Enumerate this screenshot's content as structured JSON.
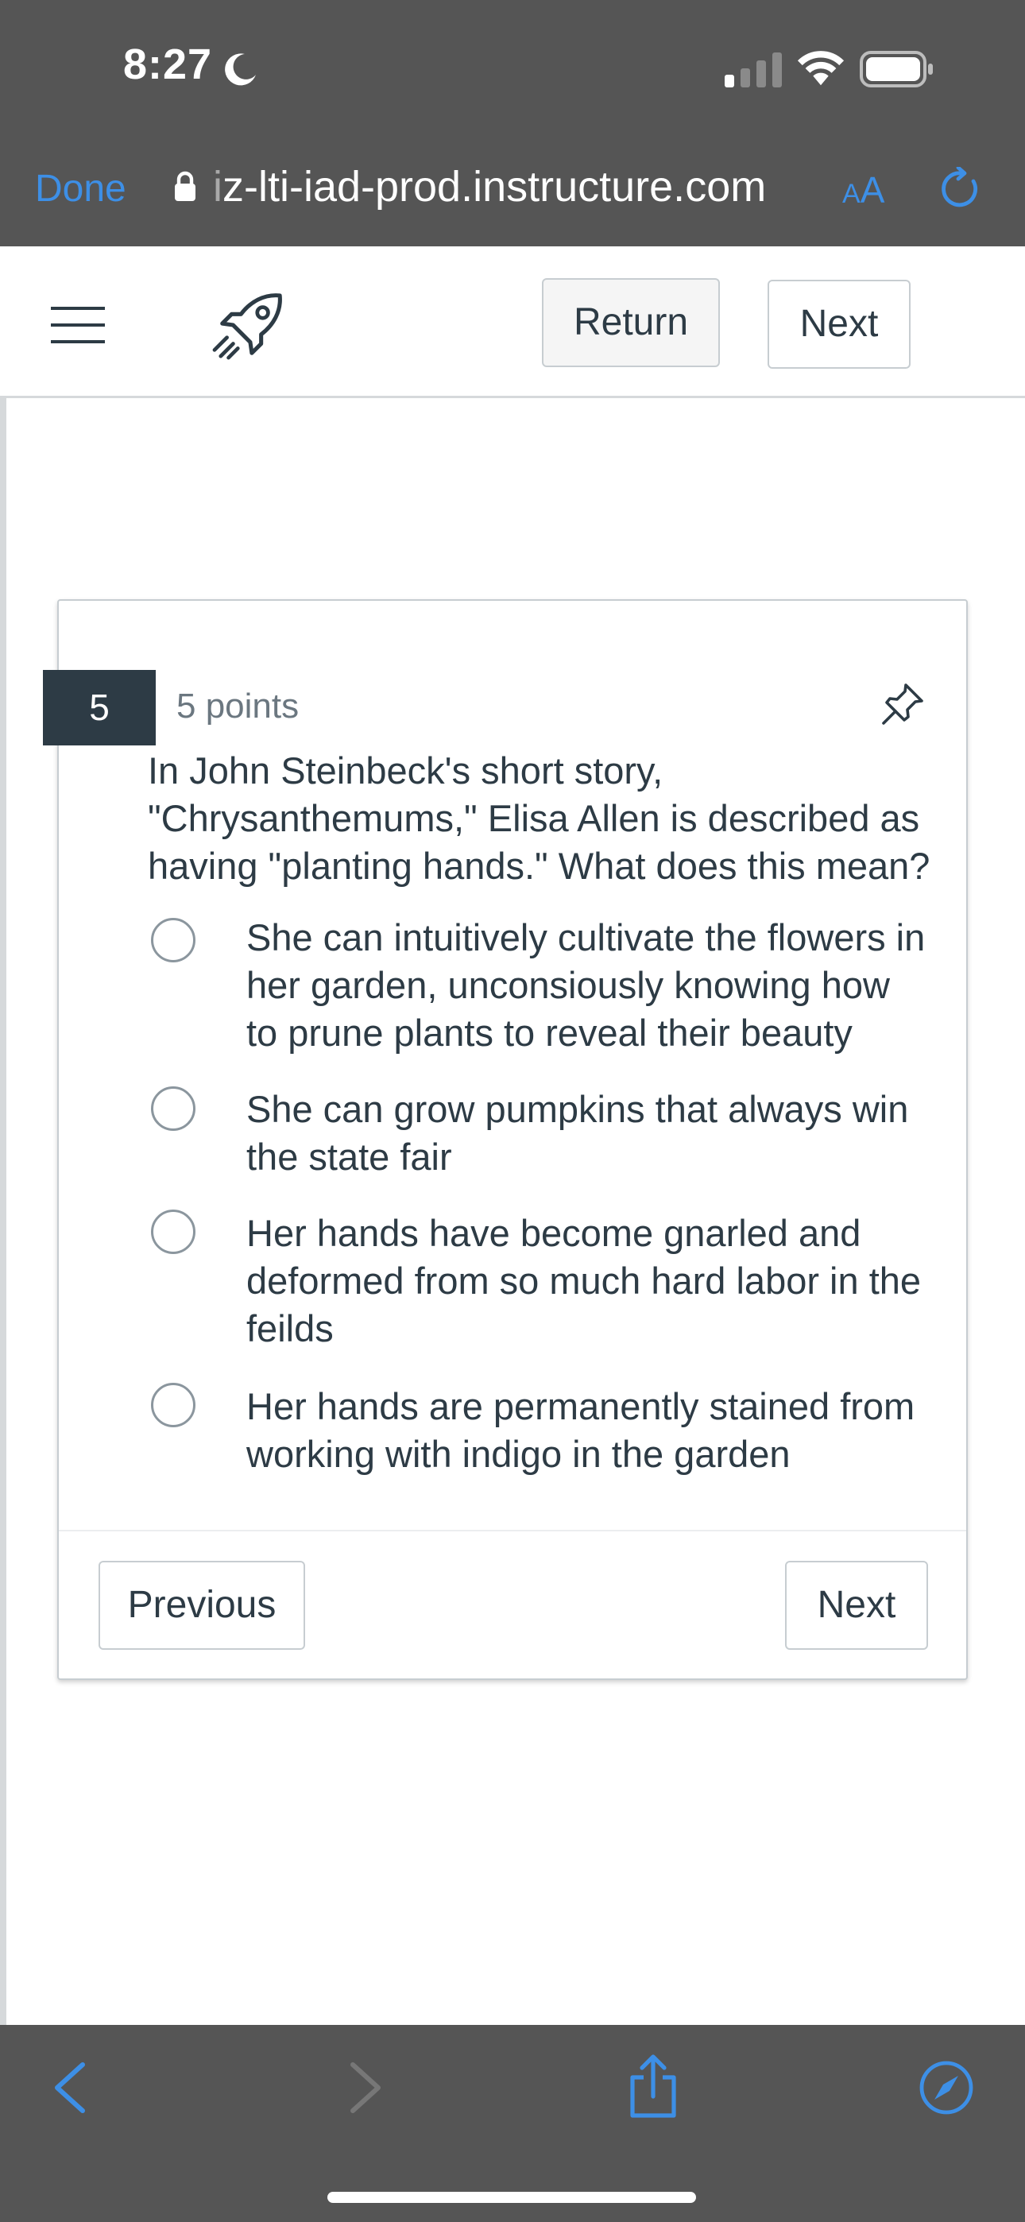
{
  "status_bar": {
    "time": "8:27",
    "icons": [
      "moon-icon",
      "cellular-signal-icon",
      "wifi-icon",
      "battery-icon"
    ]
  },
  "browser": {
    "done_label": "Done",
    "url_prefix": "i",
    "url": "z-lti-iad-prod.instructure.com",
    "aa_small": "A",
    "aa_big": "A",
    "icons": [
      "lock-icon",
      "reload-icon"
    ]
  },
  "header": {
    "icons": [
      "hamburger-menu-icon",
      "rocket-icon"
    ],
    "return_label": "Return",
    "next_label": "Next"
  },
  "question": {
    "number": "5",
    "points": "5 points",
    "text": "In John Steinbeck's short story, \"Chrysanthemums,\" Elisa Allen is described as having \"planting hands.\"  What does this mean?",
    "answers": [
      {
        "label": "She can intuitively cultivate the flowers in her garden, unconsiously knowing how to prune plants to reveal their beauty"
      },
      {
        "label": "She can grow pumpkins that always win the state fair"
      },
      {
        "label": "Her hands have become gnarled and deformed from so much hard labor in the feilds"
      },
      {
        "label": "Her hands are permanently stained from working with indigo in the garden"
      }
    ]
  },
  "card_footer": {
    "previous_label": "Previous",
    "next_label": "Next"
  },
  "toolbar": {
    "icons": [
      "back-arrow-icon",
      "forward-arrow-icon",
      "share-icon",
      "compass-icon"
    ]
  },
  "colors": {
    "chrome_bg": "#555555",
    "link_blue": "#3d8fe6",
    "text_dark": "#2d3b45",
    "question_badge": "#2d3b45"
  }
}
